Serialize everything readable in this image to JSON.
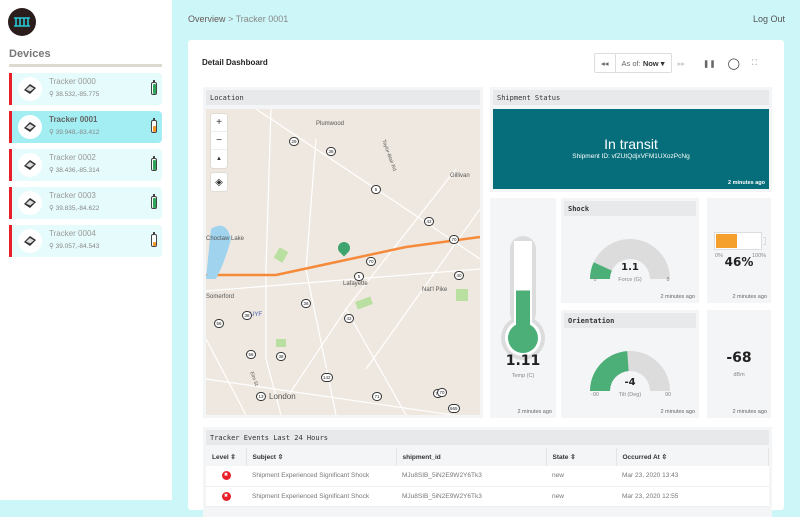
{
  "sidebar": {
    "title": "Devices",
    "devices": [
      {
        "name": "Tracker 0000",
        "coords": "38.532,-85.775",
        "battery": 0.85,
        "battery_color": "#2da55a",
        "selected": false
      },
      {
        "name": "Tracker 0001",
        "coords": "39.948,-83.412",
        "battery": 0.46,
        "battery_color": "#f5962a",
        "selected": true
      },
      {
        "name": "Tracker 0002",
        "coords": "38.436,-85.314",
        "battery": 0.85,
        "battery_color": "#2da55a",
        "selected": false
      },
      {
        "name": "Tracker 0003",
        "coords": "39.835,-84.622",
        "battery": 0.85,
        "battery_color": "#2da55a",
        "selected": false
      },
      {
        "name": "Tracker 0004",
        "coords": "39.057,-84.543",
        "battery": 0.3,
        "battery_color": "#f5962a",
        "selected": false
      }
    ]
  },
  "header": {
    "breadcrumb_root": "Overview",
    "breadcrumb_sep": " > ",
    "breadcrumb_current": "Tracker 0001",
    "logout": "Log Out"
  },
  "dashboard": {
    "title": "Detail Dashboard",
    "toolbar": {
      "rewind": "◂◂",
      "as_of_label": "As of:",
      "as_of_value": "Now ▾",
      "forward": "▸▸",
      "pause": "❚❚",
      "circle": "◯",
      "fullscreen": "⛶"
    }
  },
  "location": {
    "title": "Location",
    "controls": {
      "zoom_in": "+",
      "zoom_out": "−",
      "compass": "▲",
      "layers": "◈"
    },
    "labels": [
      "Plumwood",
      "Gillivan",
      "Choctaw Lake",
      "Lafayette",
      "Nat'l Pike",
      "Somerford",
      "KUYF",
      "London",
      "Taylor-Blair Rd",
      "Elm St"
    ],
    "shields": [
      "29",
      "38",
      "5",
      "42",
      "70",
      "70",
      "38",
      "5",
      "40",
      "56",
      "38",
      "42",
      "56",
      "38",
      "70",
      "13",
      "142",
      "71",
      "70",
      "665"
    ]
  },
  "shipment_status": {
    "title": "Shipment Status",
    "status": "In transit",
    "id_label": "Shipment ID:",
    "id": "vfZUtQdjxVFM1UXozPcNg",
    "updated": "2 minutes ago"
  },
  "temperature": {
    "value": "1.11",
    "unit": "Temp (C)",
    "fill": 0.45,
    "updated": "2 minutes ago"
  },
  "shock": {
    "title": "Shock",
    "value": "1.1",
    "unit": "Force (G)",
    "min": "0",
    "max": "8",
    "fraction": 0.1375,
    "updated": "2 minutes ago"
  },
  "battery": {
    "value": "46%",
    "min": "0%",
    "max": "100%",
    "fraction": 0.46,
    "color": "#f5a02c",
    "updated": "2 minutes ago"
  },
  "orientation": {
    "title": "Orientation",
    "value": "-4",
    "unit": "Tilt (Deg)",
    "min": "-90",
    "max": "90",
    "fraction": 0.478,
    "updated": "2 minutes ago"
  },
  "signal": {
    "value": "-68",
    "unit": "dBm",
    "updated": "2 minutes ago"
  },
  "events": {
    "title": "Tracker Events Last 24 Hours",
    "columns": [
      "Level ⇳",
      "Subject ⇳",
      "shipment_id",
      "State ⇳",
      "Occurred At ⇳"
    ],
    "rows": [
      {
        "level": "✖",
        "subject": "Shipment Experienced Significant Shock",
        "shipment_id": "MJu8SIB_5iN2E9W2Y6Tk3",
        "state": "new",
        "occurred": "Mar 23, 2020 13:43"
      },
      {
        "level": "✖",
        "subject": "Shipment Experienced Significant Shock",
        "shipment_id": "MJu8SIB_5iN2E9W2Y6Tk3",
        "state": "new",
        "occurred": "Mar 23, 2020 12:55"
      }
    ]
  },
  "colors": {
    "accent_green": "#4caf78",
    "status_teal": "#066e7a",
    "alert_red": "#e8202a",
    "battery_orange": "#f5a02c"
  }
}
